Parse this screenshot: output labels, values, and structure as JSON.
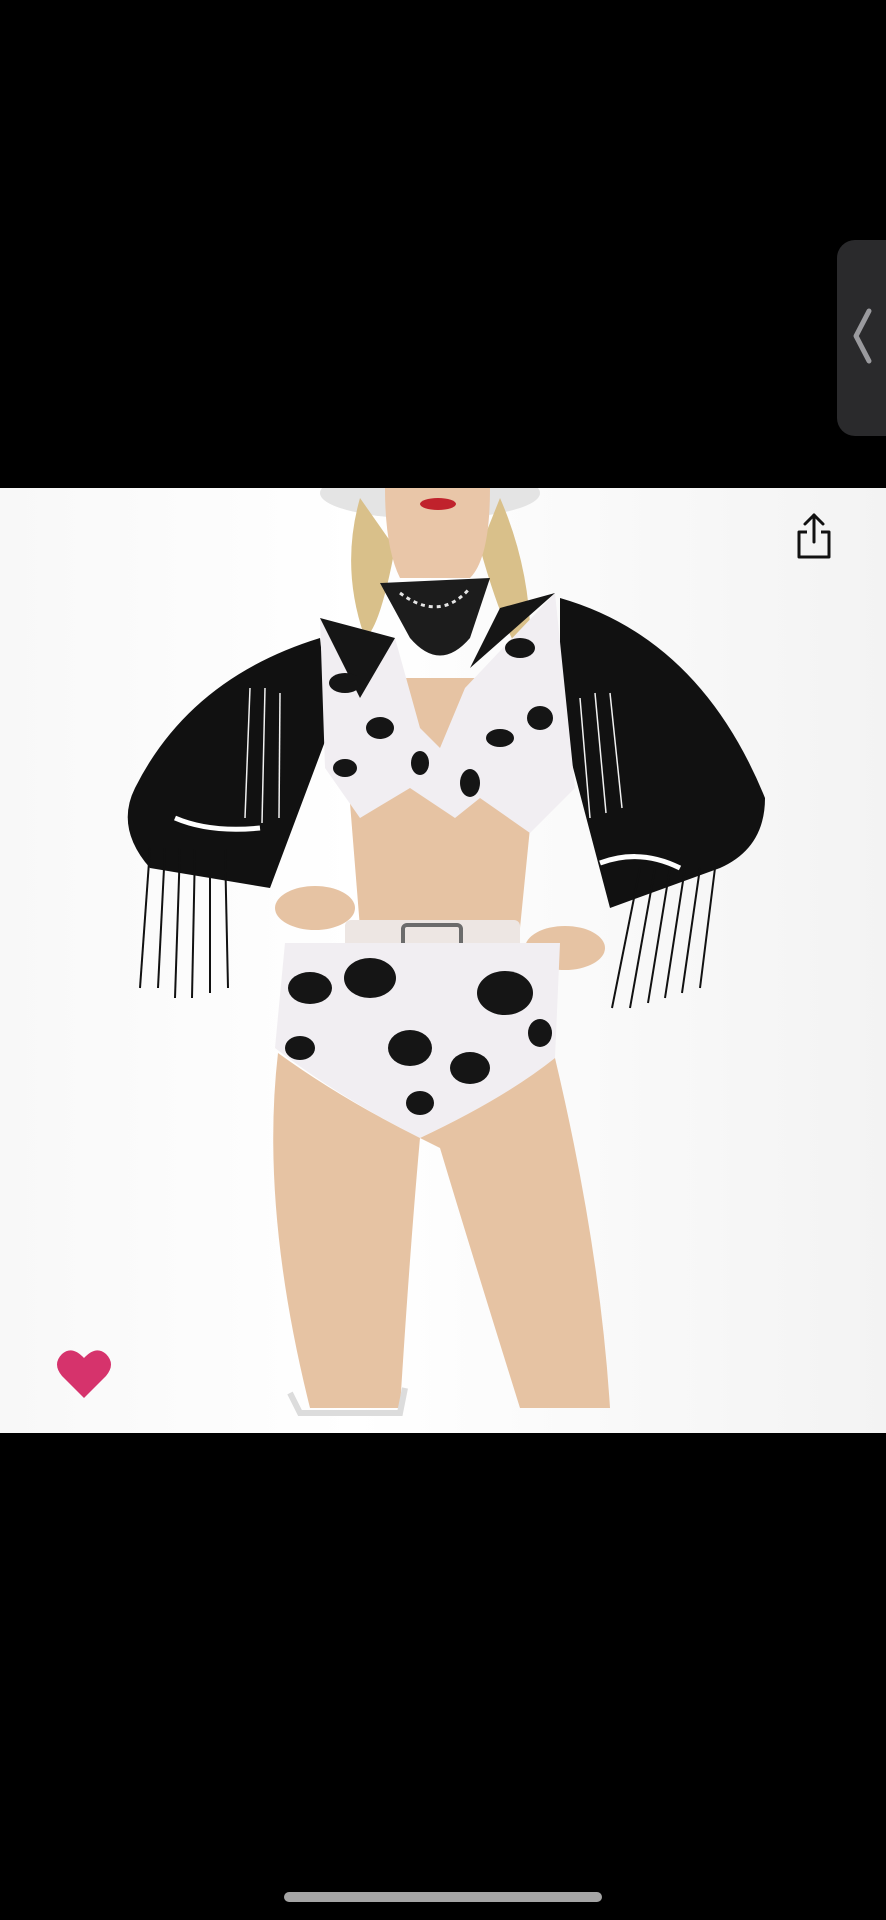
{
  "viewer": {
    "background": "#000000",
    "photo_background": "#ffffff"
  },
  "controls": {
    "side_handle_icon": "chevron-left-icon",
    "share_icon": "share-icon",
    "favorite_icon": "heart-icon",
    "favorite_color": "#d6336c",
    "favorite_active": true
  },
  "home_indicator": {
    "color": "#a5a5a5"
  }
}
